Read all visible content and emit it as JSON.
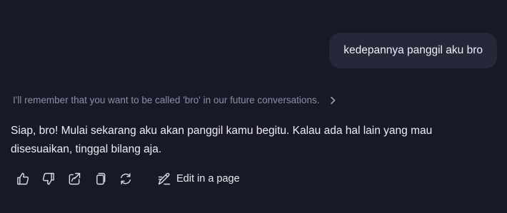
{
  "user_message": {
    "text": "kedepannya panggil aku bro"
  },
  "memory_note": {
    "text": "I'll remember that you want to be called 'bro' in our future conversations.",
    "icon": "chevron-right-icon"
  },
  "assistant_response": {
    "text": "Siap, bro! Mulai sekarang aku akan panggil kamu begitu. Kalau ada hal lain yang mau disesuaikan, tinggal bilang aja."
  },
  "actions": {
    "icons": [
      "thumbs-up-icon",
      "thumbs-down-icon",
      "share-icon",
      "copy-icon",
      "regenerate-icon"
    ],
    "edit_label": "Edit in a page",
    "edit_icon": "edit-page-icon"
  },
  "colors": {
    "background": "#171a26",
    "user_bubble": "#242839",
    "muted_text": "#8a8fa3",
    "text": "#eceef4"
  }
}
